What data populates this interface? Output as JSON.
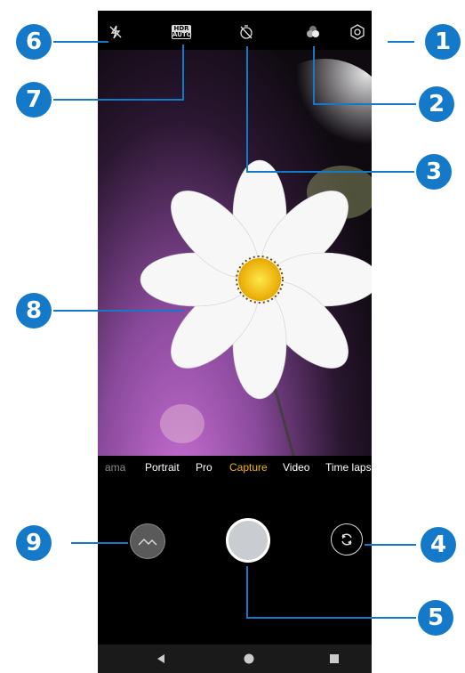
{
  "camera": {
    "modes": [
      {
        "label": "ama",
        "state": "faded"
      },
      {
        "label": "Portrait",
        "state": "normal"
      },
      {
        "label": "Pro",
        "state": "normal"
      },
      {
        "label": "Capture",
        "state": "active"
      },
      {
        "label": "Video",
        "state": "normal"
      },
      {
        "label": "Time lapse",
        "state": "normal"
      }
    ],
    "hdr": {
      "top": "HDR",
      "bottom": "AUTO"
    },
    "accent_color": "#f5b400"
  },
  "callouts": {
    "n1": "1",
    "n2": "2",
    "n3": "3",
    "n4": "4",
    "n5": "5",
    "n6": "6",
    "n7": "7",
    "n8": "8",
    "n9": "9",
    "color": "#1479c8"
  }
}
